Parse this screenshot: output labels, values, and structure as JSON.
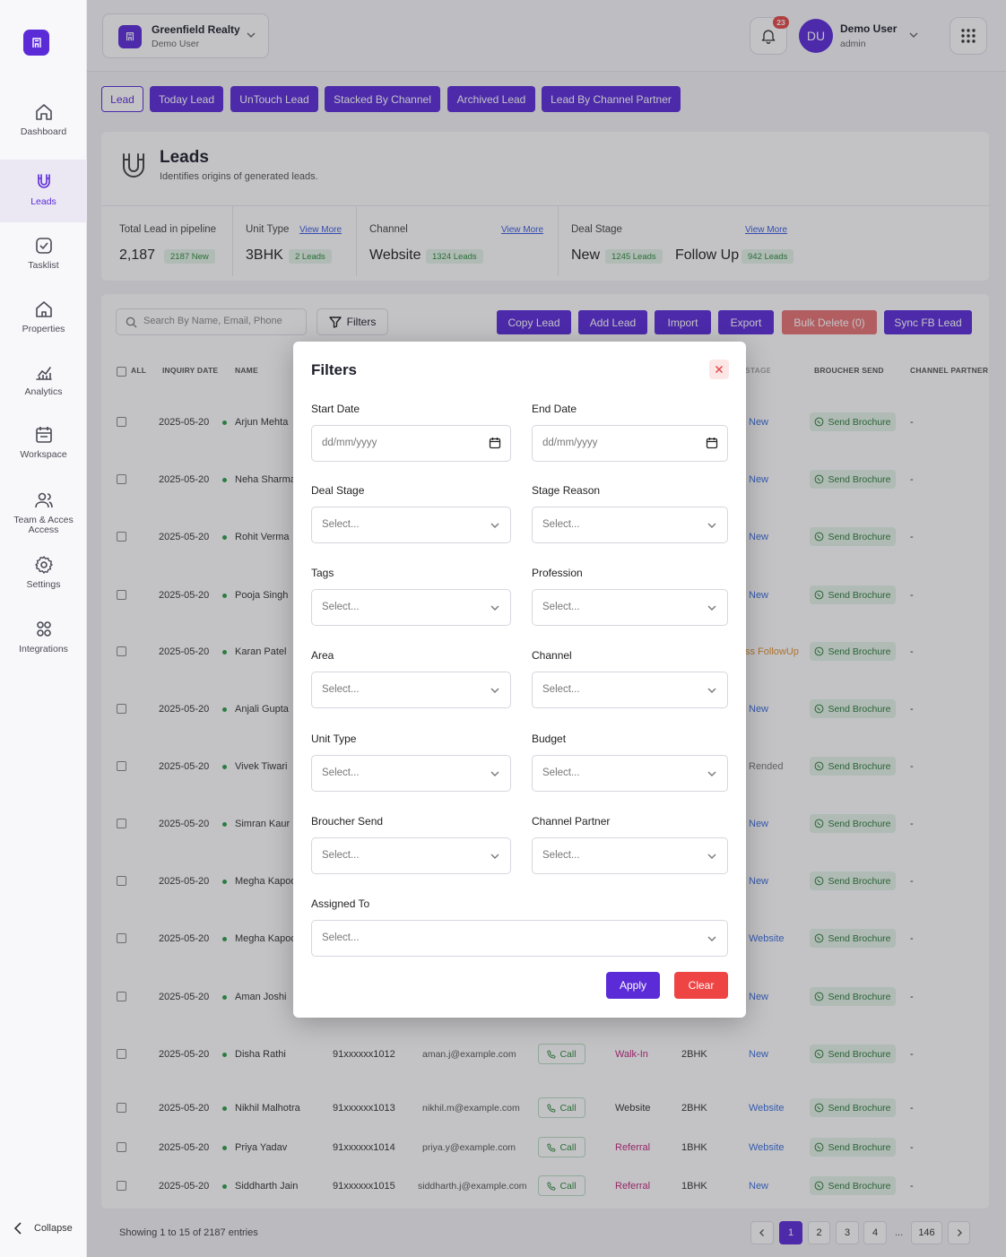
{
  "sidebar": {
    "items": [
      {
        "label": "Dashboard",
        "icon": "home-icon"
      },
      {
        "label": "Leads",
        "icon": "magnet-icon"
      },
      {
        "label": "Tasklist",
        "icon": "checklist-icon"
      },
      {
        "label": "Properties",
        "icon": "house-icon"
      },
      {
        "label": "Analytics",
        "icon": "chart-icon"
      },
      {
        "label": "Workspace",
        "icon": "calendar-icon"
      },
      {
        "label": "Team & Acces Access",
        "icon": "users-icon"
      },
      {
        "label": "Settings",
        "icon": "gear-icon"
      },
      {
        "label": "Integrations",
        "icon": "integrations-icon"
      }
    ],
    "collapse_label": "Collapse"
  },
  "header": {
    "org_name": "Greenfield Realty",
    "org_sub": "Demo User",
    "notifications": "23",
    "avatar": "DU",
    "user_name": "Demo User",
    "user_role": "admin"
  },
  "tabs": [
    "Lead",
    "Today Lead",
    "UnTouch Lead",
    "Stacked By Channel",
    "Archived Lead",
    "Lead By Channel Partner"
  ],
  "leads": {
    "title": "Leads",
    "subtitle": "Identifies origins of generated leads."
  },
  "stats": {
    "total_label": "Total Lead in pipeline",
    "total_value": "2,187",
    "total_badge": "2187 New",
    "unit_label": "Unit Type",
    "unit_value": "3BHK",
    "unit_badge": "2 Leads",
    "channel_label": "Channel",
    "channel_value": "Website",
    "channel_badge": "1324 Leads",
    "deal_label": "Deal Stage",
    "deal_value1": "New",
    "deal_badge1": "1245 Leads",
    "deal_value2": "Follow Up",
    "deal_badge2": "942 Leads",
    "view_more": "View More"
  },
  "toolbar": {
    "search_placeholder": "Search By Name, Email, Phone",
    "filters": "Filters",
    "copy": "Copy Lead",
    "add": "Add Lead",
    "import": "Import",
    "export": "Export",
    "bulk_delete": "Bulk Delete (0)",
    "sync": "Sync FB Lead"
  },
  "table": {
    "headers": {
      "all": "ALL",
      "inquiry_date": "INQUIRY DATE",
      "name": "NAME",
      "stage": "STAGE",
      "broucher": "BROUCHER SEND",
      "partner": "CHANNEL PARTNER"
    },
    "call_label": "Call",
    "brochure_label": "Send Brochure",
    "rows": [
      {
        "date": "2025-05-20",
        "name": "Arjun Mehta",
        "stage": "New"
      },
      {
        "date": "2025-05-20",
        "name": "Neha Sharma",
        "stage": "New"
      },
      {
        "date": "2025-05-20",
        "name": "Rohit Verma",
        "stage": "New"
      },
      {
        "date": "2025-05-20",
        "name": "Pooja Singh",
        "stage": "New"
      },
      {
        "date": "2025-05-20",
        "name": "Karan Patel",
        "stage": "ss FollowUp"
      },
      {
        "date": "2025-05-20",
        "name": "Anjali Gupta",
        "stage": "New"
      },
      {
        "date": "2025-05-20",
        "name": "Vivek Tiwari",
        "stage": "Rended"
      },
      {
        "date": "2025-05-20",
        "name": "Simran Kaur",
        "stage": "New"
      },
      {
        "date": "2025-05-20",
        "name": "Megha Kapoor",
        "stage": "New"
      },
      {
        "date": "2025-05-20",
        "name": "Megha Kapoor",
        "stage": "Website"
      },
      {
        "date": "2025-05-20",
        "name": "Aman Joshi",
        "stage": "New"
      },
      {
        "date": "2025-05-20",
        "name": "Disha Rathi",
        "phone": "91xxxxxx1012",
        "email": "aman.j@example.com",
        "channel": "Walk-In",
        "unit": "2BHK",
        "stage": "New"
      },
      {
        "date": "2025-05-20",
        "name": "Nikhil Malhotra",
        "phone": "91xxxxxx1013",
        "email": "nikhil.m@example.com",
        "channel": "Website",
        "unit": "2BHK",
        "stage": "Website"
      },
      {
        "date": "2025-05-20",
        "name": "Priya Yadav",
        "phone": "91xxxxxx1014",
        "email": "priya.y@example.com",
        "channel": "Referral",
        "unit": "1BHK",
        "stage": "Website"
      },
      {
        "date": "2025-05-20",
        "name": "Siddharth Jain",
        "phone": "91xxxxxx1015",
        "email": "siddharth.j@example.com",
        "channel": "Referral",
        "unit": "1BHK",
        "stage": "New"
      }
    ],
    "partner_value": "-"
  },
  "pagination": {
    "showing": "Showing 1 to 15 of 2187 entries",
    "pages": [
      "1",
      "2",
      "3",
      "4"
    ],
    "ellipsis": "...",
    "last": "146"
  },
  "modal": {
    "title": "Filters",
    "start_date": "Start Date",
    "end_date": "End Date",
    "date_placeholder": "dd/mm/yyyy",
    "select_placeholder": "Select...",
    "fields": [
      "Deal Stage",
      "Stage Reason",
      "Tags",
      "Profession",
      "Area",
      "Channel",
      "Unit Type",
      "Budget",
      "Broucher Send",
      "Channel Partner"
    ],
    "assigned_to": "Assigned To",
    "apply": "Apply",
    "clear": "Clear"
  },
  "colors": {
    "accent": "#5b2bd8",
    "danger": "#ef4444",
    "success": "#2f8a3c"
  }
}
